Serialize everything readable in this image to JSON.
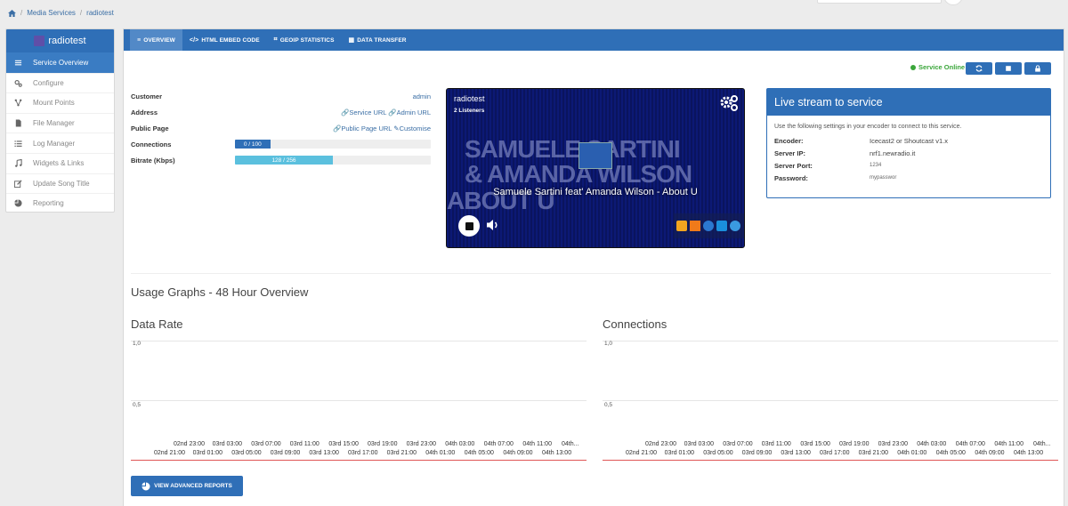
{
  "breadcrumb": {
    "items": [
      "Media Services",
      "radiotest"
    ],
    "home_icon": "home-icon"
  },
  "sidebar": {
    "title": "radiotest",
    "items": [
      {
        "label": "Service Overview",
        "icon": "bars-icon",
        "active": true
      },
      {
        "label": "Configure",
        "icon": "cogs-icon"
      },
      {
        "label": "Mount Points",
        "icon": "sitemap-icon"
      },
      {
        "label": "File Manager",
        "icon": "file-icon"
      },
      {
        "label": "Log Manager",
        "icon": "list-icon"
      },
      {
        "label": "Widgets & Links",
        "icon": "music-icon"
      },
      {
        "label": "Update Song Title",
        "icon": "edit-icon"
      },
      {
        "label": "Reporting",
        "icon": "pie-chart-icon"
      }
    ]
  },
  "tabs": [
    {
      "label": "OVERVIEW",
      "icon": "≡",
      "active": true
    },
    {
      "label": "HTML EMBED CODE",
      "icon": "</>"
    },
    {
      "label": "GEOIP STATISTICS",
      "icon": "⌗"
    },
    {
      "label": "DATA TRANSFER",
      "icon": "▦"
    }
  ],
  "status": {
    "label": "Service Online",
    "color": "#3aa63a"
  },
  "controls": {
    "refresh_icon": "refresh-icon",
    "stop_icon": "stop-icon",
    "lock_icon": "lock-icon"
  },
  "info": {
    "customer_label": "Customer",
    "customer_value": "admin",
    "address_label": "Address",
    "service_url": "Service URL",
    "admin_url": "Admin URL",
    "public_label": "Public Page",
    "public_url": "Public Page URL",
    "customise": "Customise",
    "connections_label": "Connections",
    "connections_value": "0 / 100",
    "connections_fraction": 0.01,
    "bitrate_label": "Bitrate (Kbps)",
    "bitrate_value": "128 / 256",
    "bitrate_fraction": 0.5
  },
  "player": {
    "title": "radiotest",
    "listeners": "2 Listeners",
    "song": "Samuele Sartini feat' Amanda Wilson - About U",
    "bg_line1": "SAMUELE SARTINI",
    "bg_line2": "& AMANDA WILSON",
    "bg_line3": "ABOUT U"
  },
  "live": {
    "title": "Live stream to service",
    "desc": "Use the following settings in your encoder to connect to this service.",
    "rows": [
      {
        "k": "Encoder:",
        "v": "Icecast2 or Shoutcast v1.x"
      },
      {
        "k": "Server IP:",
        "v": "nrf1.newradio.it"
      },
      {
        "k": "Server Port:",
        "v": "1234"
      },
      {
        "k": "Password:",
        "v": "mypasswor"
      }
    ]
  },
  "usage": {
    "heading": "Usage Graphs - 48 Hour Overview",
    "graphs": [
      {
        "title": "Data Rate",
        "y1": "1,0",
        "y2": "0,5"
      },
      {
        "title": "Connections",
        "y1": "1,0",
        "y2": "0,5"
      }
    ],
    "x_upper": [
      "02nd 23:00",
      "03rd 03:00",
      "03rd 07:00",
      "03rd 11:00",
      "03rd 15:00",
      "03rd 19:00",
      "03rd 23:00",
      "04th 03:00",
      "04th 07:00",
      "04th 11:00",
      "04th..."
    ],
    "x_lower": [
      "02nd 21:00",
      "03rd 01:00",
      "03rd 05:00",
      "03rd 09:00",
      "03rd 13:00",
      "03rd 17:00",
      "03rd 21:00",
      "04th 01:00",
      "04th 05:00",
      "04th 09:00",
      "04th 13:00"
    ]
  },
  "advanced_button": "VIEW ADVANCED REPORTS"
}
